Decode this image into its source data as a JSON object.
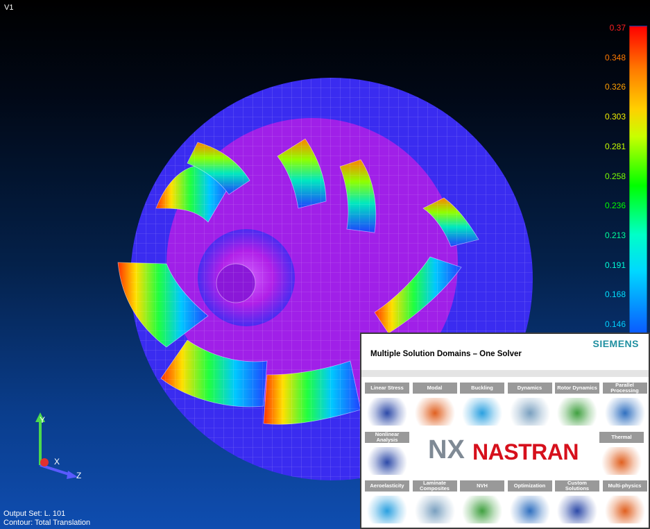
{
  "viewport": {
    "label": "V1",
    "output_set": "Output Set: L. 101",
    "contour": "Contour: Total Translation"
  },
  "legend": {
    "values": [
      "0.37",
      "0.348",
      "0.326",
      "0.303",
      "0.281",
      "0.258",
      "0.236",
      "0.213",
      "0.191",
      "0.168",
      "0.146"
    ],
    "colors": [
      "#ff2020",
      "#ff7a00",
      "#ffa000",
      "#f0f000",
      "#c8ff00",
      "#7cff00",
      "#00ff00",
      "#00ff9a",
      "#00ffd8",
      "#00e0ff",
      "#00d0ff"
    ]
  },
  "axes": {
    "y": "Y",
    "x": "X",
    "z": "Z"
  },
  "panel": {
    "title": "Multiple Solution Domains – One Solver",
    "brand": "SIEMENS",
    "logo_nx": "NX",
    "logo_nastran": "NASTRAN",
    "domains_top": [
      "Linear Stress",
      "Modal",
      "Buckling",
      "Dynamics",
      "Rotor Dynamics",
      "Parallel Processing"
    ],
    "domain_left": "Nonlinear Analysis",
    "domain_right": "Thermal",
    "domains_bottom": [
      "Aeroelasticity",
      "Laminate Composites",
      "NVH",
      "Optimization",
      "Custom Solutions",
      "Multi-physics"
    ]
  }
}
